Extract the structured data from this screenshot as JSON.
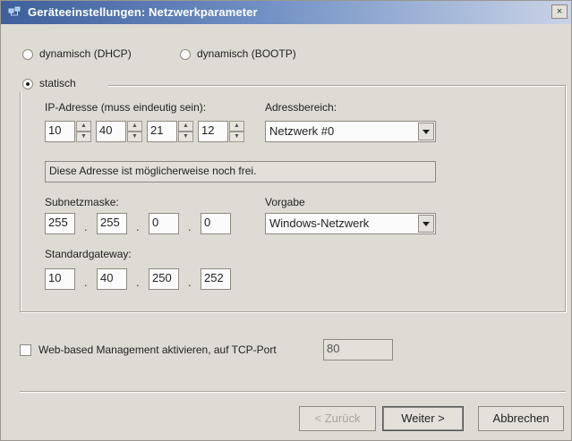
{
  "window": {
    "title": "Geräteeinstellungen: Netzwerkparameter",
    "close_glyph": "×"
  },
  "mode": {
    "dhcp_label": "dynamisch (DHCP)",
    "bootp_label": "dynamisch (BOOTP)",
    "static_label": "statisch",
    "selected": "statisch"
  },
  "ip": {
    "label": "IP-Adresse (muss eindeutig sein):",
    "octets": [
      "10",
      "40",
      "21",
      "12"
    ]
  },
  "range": {
    "label": "Adressbereich:",
    "value": "Netzwerk #0"
  },
  "status_message": "Diese Adresse ist möglicherweise noch frei.",
  "subnet": {
    "label": "Subnetzmaske:",
    "octets": [
      "255",
      "255",
      "0",
      "0"
    ]
  },
  "preset": {
    "label": "Vorgabe",
    "value": "Windows-Netzwerk"
  },
  "gateway": {
    "label": "Standardgateway:",
    "octets": [
      "10",
      "40",
      "250",
      "252"
    ]
  },
  "separator_dot": ".",
  "web_management": {
    "label": "Web-based Management aktivieren, auf TCP-Port",
    "checked": false,
    "port": "80"
  },
  "buttons": {
    "back": "< Zurück",
    "next": "Weiter >",
    "cancel": "Abbrechen"
  },
  "icons": [
    "network-icon",
    "close-icon",
    "spin-up-icon",
    "spin-down-icon",
    "dropdown-arrow-icon"
  ]
}
